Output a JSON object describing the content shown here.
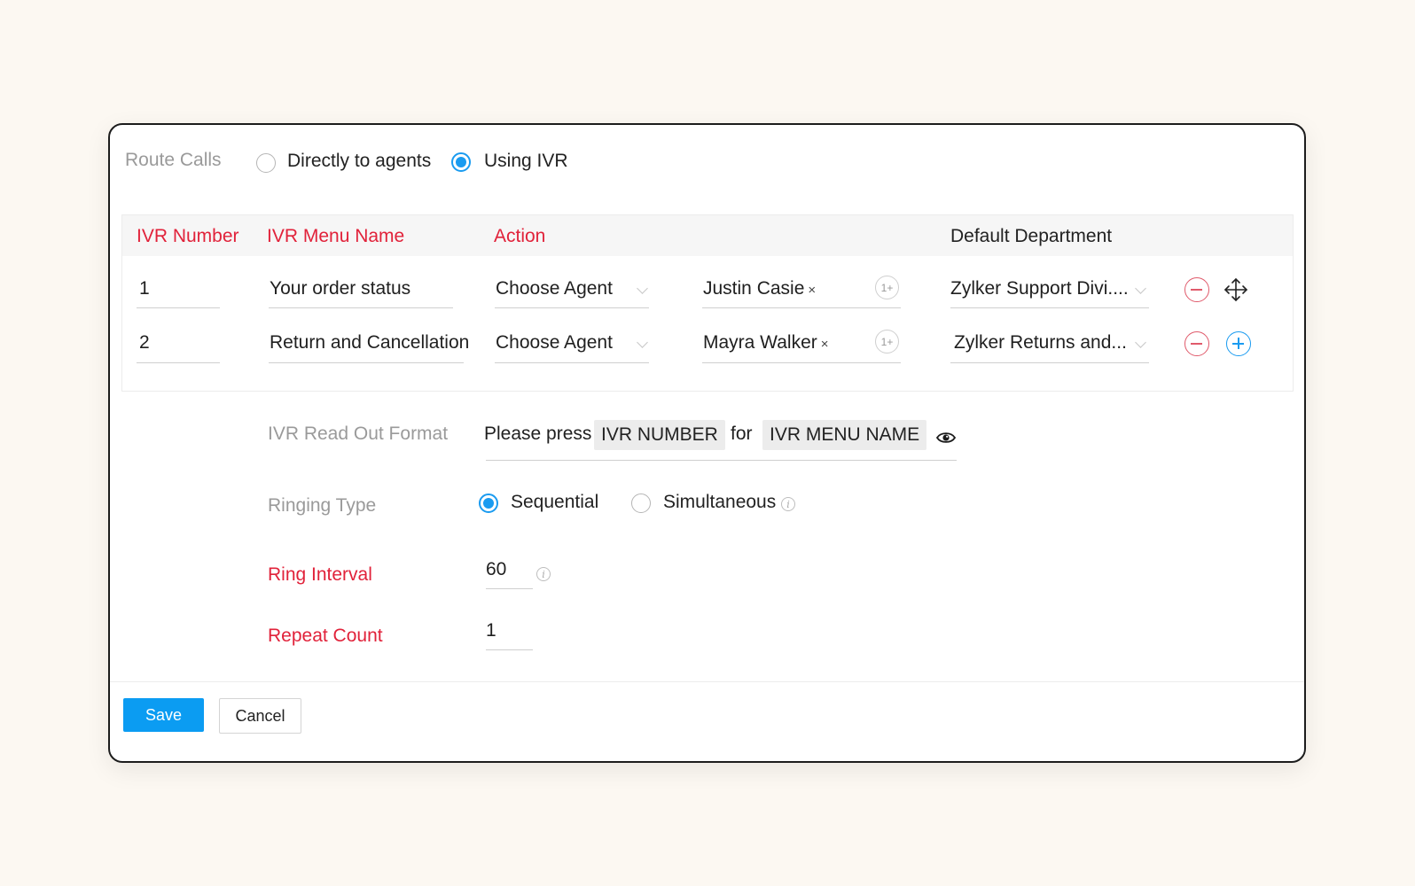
{
  "route": {
    "label": "Route Calls",
    "options": [
      {
        "label": "Directly to agents",
        "selected": false
      },
      {
        "label": "Using IVR",
        "selected": true
      }
    ]
  },
  "table": {
    "headers": {
      "ivr_number": "IVR Number",
      "menu_name": "IVR Menu Name",
      "action": "Action",
      "default_department": "Default Department"
    },
    "rows": [
      {
        "number": "1",
        "menu_name": "Your order status",
        "action": "Choose Agent",
        "agent": "Justin Casie",
        "more_badge": "1+",
        "department": "Zylker Support Divi...."
      },
      {
        "number": "2",
        "menu_name": "Return and Cancellation",
        "action": "Choose Agent",
        "agent": "Mayra Walker",
        "more_badge": "1+",
        "department": "Zylker Returns and..."
      }
    ],
    "remove_glyph": "×"
  },
  "readout": {
    "label": "IVR Read Out Format",
    "prefix": "Please press",
    "chip_number": "IVR NUMBER",
    "joiner": "for",
    "chip_menu": "IVR MENU NAME"
  },
  "ringing": {
    "label": "Ringing Type",
    "options": [
      {
        "label": "Sequential",
        "selected": true
      },
      {
        "label": "Simultaneous",
        "selected": false
      }
    ]
  },
  "ring_interval": {
    "label": "Ring Interval",
    "value": "60"
  },
  "repeat_count": {
    "label": "Repeat Count",
    "value": "1"
  },
  "info_glyph": "i",
  "footer": {
    "save": "Save",
    "cancel": "Cancel"
  },
  "colors": {
    "accent": "#0b9cf2",
    "required": "#e1223a",
    "remove": "#e05a6b"
  }
}
